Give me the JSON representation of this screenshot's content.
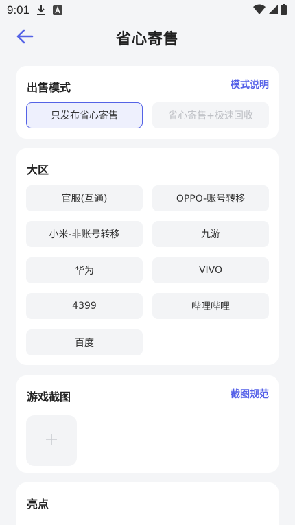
{
  "status_bar": {
    "time": "9:01",
    "icons": [
      "download-icon",
      "app-notification-icon",
      "wifi-icon",
      "signal-icon",
      "battery-icon"
    ]
  },
  "header": {
    "title": "省心寄售",
    "back_icon": "arrow-left-icon"
  },
  "sale_mode": {
    "title": "出售模式",
    "link": "模式说明",
    "options": [
      {
        "label": "只发布省心寄售",
        "selected": true,
        "disabled": false
      },
      {
        "label": "省心寄售+极速回收",
        "selected": false,
        "disabled": true
      }
    ]
  },
  "region": {
    "title": "大区",
    "options": [
      "官服(互通)",
      "OPPO-账号转移",
      "小米-非账号转移",
      "九游",
      "华为",
      "VIVO",
      "4399",
      "哔哩哔哩",
      "百度"
    ]
  },
  "screenshots": {
    "title": "游戏截图",
    "link": "截图规范",
    "upload_icon": "plus-icon"
  },
  "highlights": {
    "title": "亮点"
  },
  "colors": {
    "accent": "#5460E8",
    "background": "#F4F5F7",
    "card": "#FFFFFF",
    "option_bg": "#F3F4F6",
    "selected_bg": "#EEF0FD"
  }
}
